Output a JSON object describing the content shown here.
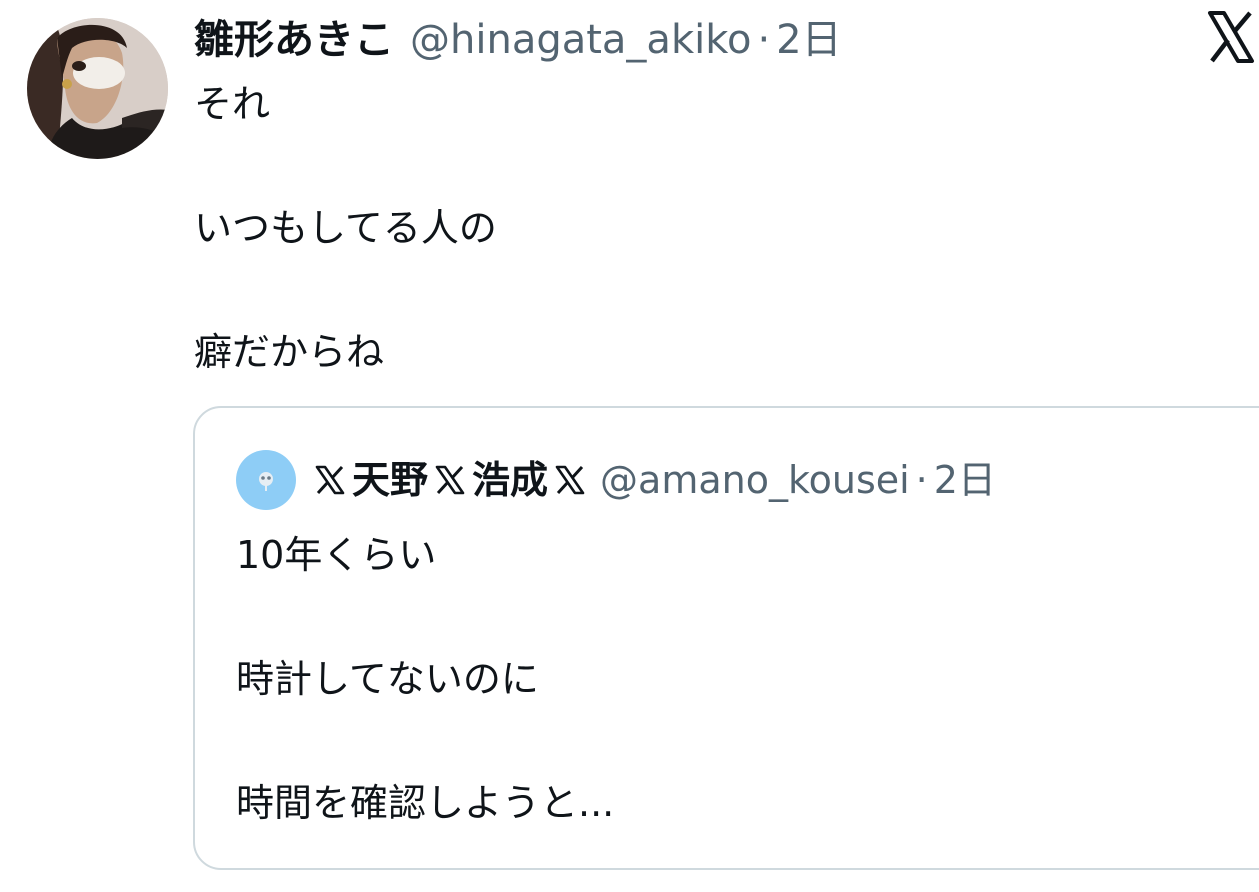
{
  "tweet": {
    "display_name": "雛形あきこ",
    "handle": "@hinagata_akiko",
    "separator": "·",
    "time": "2日",
    "lines": [
      "それ",
      "いつもしてる人の",
      "癖だからね"
    ],
    "platform_icon": "x-logo-icon"
  },
  "quote": {
    "name_part_1": "天野",
    "name_part_2": "浩成",
    "name_decoration_icon": "x-logo-icon",
    "handle": "@amano_kousei",
    "separator": "·",
    "time": "2日",
    "lines": [
      "10年くらい",
      "時計してないのに",
      "時間を確認しようと..."
    ]
  },
  "colors": {
    "text_primary": "#0f1419",
    "text_secondary": "#536471",
    "border": "#cfd9de",
    "quote_avatar_bg": "#8ecdf6"
  }
}
